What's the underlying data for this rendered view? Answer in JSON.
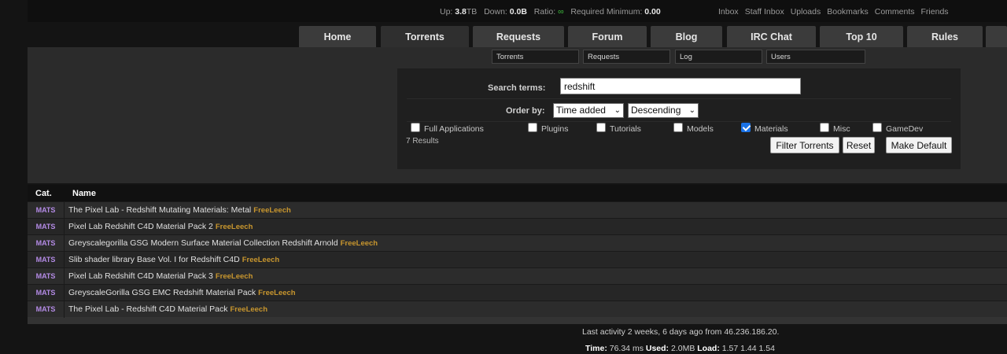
{
  "topbar": {
    "up_label": "Up:",
    "up_value": "3.8",
    "up_unit": "TB",
    "down_label": "Down:",
    "down_value": "0.0B",
    "ratio_label": "Ratio:",
    "ratio_value": "∞",
    "required_label": "Required Minimum:",
    "required_value": "0.00",
    "links": [
      "Inbox",
      "Staff Inbox",
      "Uploads",
      "Bookmarks",
      "Comments",
      "Friends"
    ]
  },
  "menu": {
    "tabs": [
      "Home",
      "Torrents",
      "Requests",
      "Forum",
      "Blog",
      "IRC Chat",
      "Top 10",
      "Rules"
    ],
    "active": "Torrents"
  },
  "quick_search": [
    "Torrents",
    "Requests",
    "Log",
    "Users"
  ],
  "search": {
    "terms_label": "Search terms:",
    "terms_value": "redshift",
    "order_label": "Order by:",
    "order_field": "Time added",
    "order_direction": "Descending",
    "categories": [
      {
        "label": "Full Applications",
        "checked": false
      },
      {
        "label": "Plugins",
        "checked": false
      },
      {
        "label": "Tutorials",
        "checked": false
      },
      {
        "label": "Models",
        "checked": false
      },
      {
        "label": "Materials",
        "checked": true
      },
      {
        "label": "Misc",
        "checked": false
      },
      {
        "label": "GameDev",
        "checked": false
      }
    ],
    "results_count": "7 Results",
    "filter_button": "Filter Torrents",
    "reset_button": "Reset",
    "default_button": "Make Default"
  },
  "table": {
    "col_cat": "Cat.",
    "col_name": "Name",
    "rows": [
      {
        "cat": "MATS",
        "name": "The Pixel Lab - Redshift Mutating Materials: Metal",
        "tag": "FreeLeech"
      },
      {
        "cat": "MATS",
        "name": "Pixel Lab Redshift C4D Material Pack 2",
        "tag": "FreeLeech"
      },
      {
        "cat": "MATS",
        "name": "Greyscalegorilla GSG Modern Surface Material Collection Redshift Arnold",
        "tag": "FreeLeech"
      },
      {
        "cat": "MATS",
        "name": "Slib shader library Base Vol. I for Redshift C4D",
        "tag": "FreeLeech"
      },
      {
        "cat": "MATS",
        "name": "Pixel Lab Redshift C4D Material Pack 3",
        "tag": "FreeLeech"
      },
      {
        "cat": "MATS",
        "name": "GreyscaleGorilla GSG EMC Redshift Material Pack",
        "tag": "FreeLeech"
      },
      {
        "cat": "MATS",
        "name": "The Pixel Lab - Redshift C4D Material Pack",
        "tag": "FreeLeech"
      }
    ]
  },
  "footer": {
    "last_activity": "Last activity 2 weeks, 6 days ago from 46.236.186.20.",
    "time_label": "Time:",
    "time_value": "76.34 ms",
    "used_label": "Used:",
    "used_value": "2.0MB",
    "load_label": "Load:",
    "load_value": "1.57 1.44 1.54"
  },
  "colors": {
    "background": "#141414",
    "panel": "#2b2b2b",
    "tab": "#3b3b3b",
    "category": "#b48be6",
    "freeleech": "#c8962e",
    "ratio": "#3fbf3f"
  }
}
